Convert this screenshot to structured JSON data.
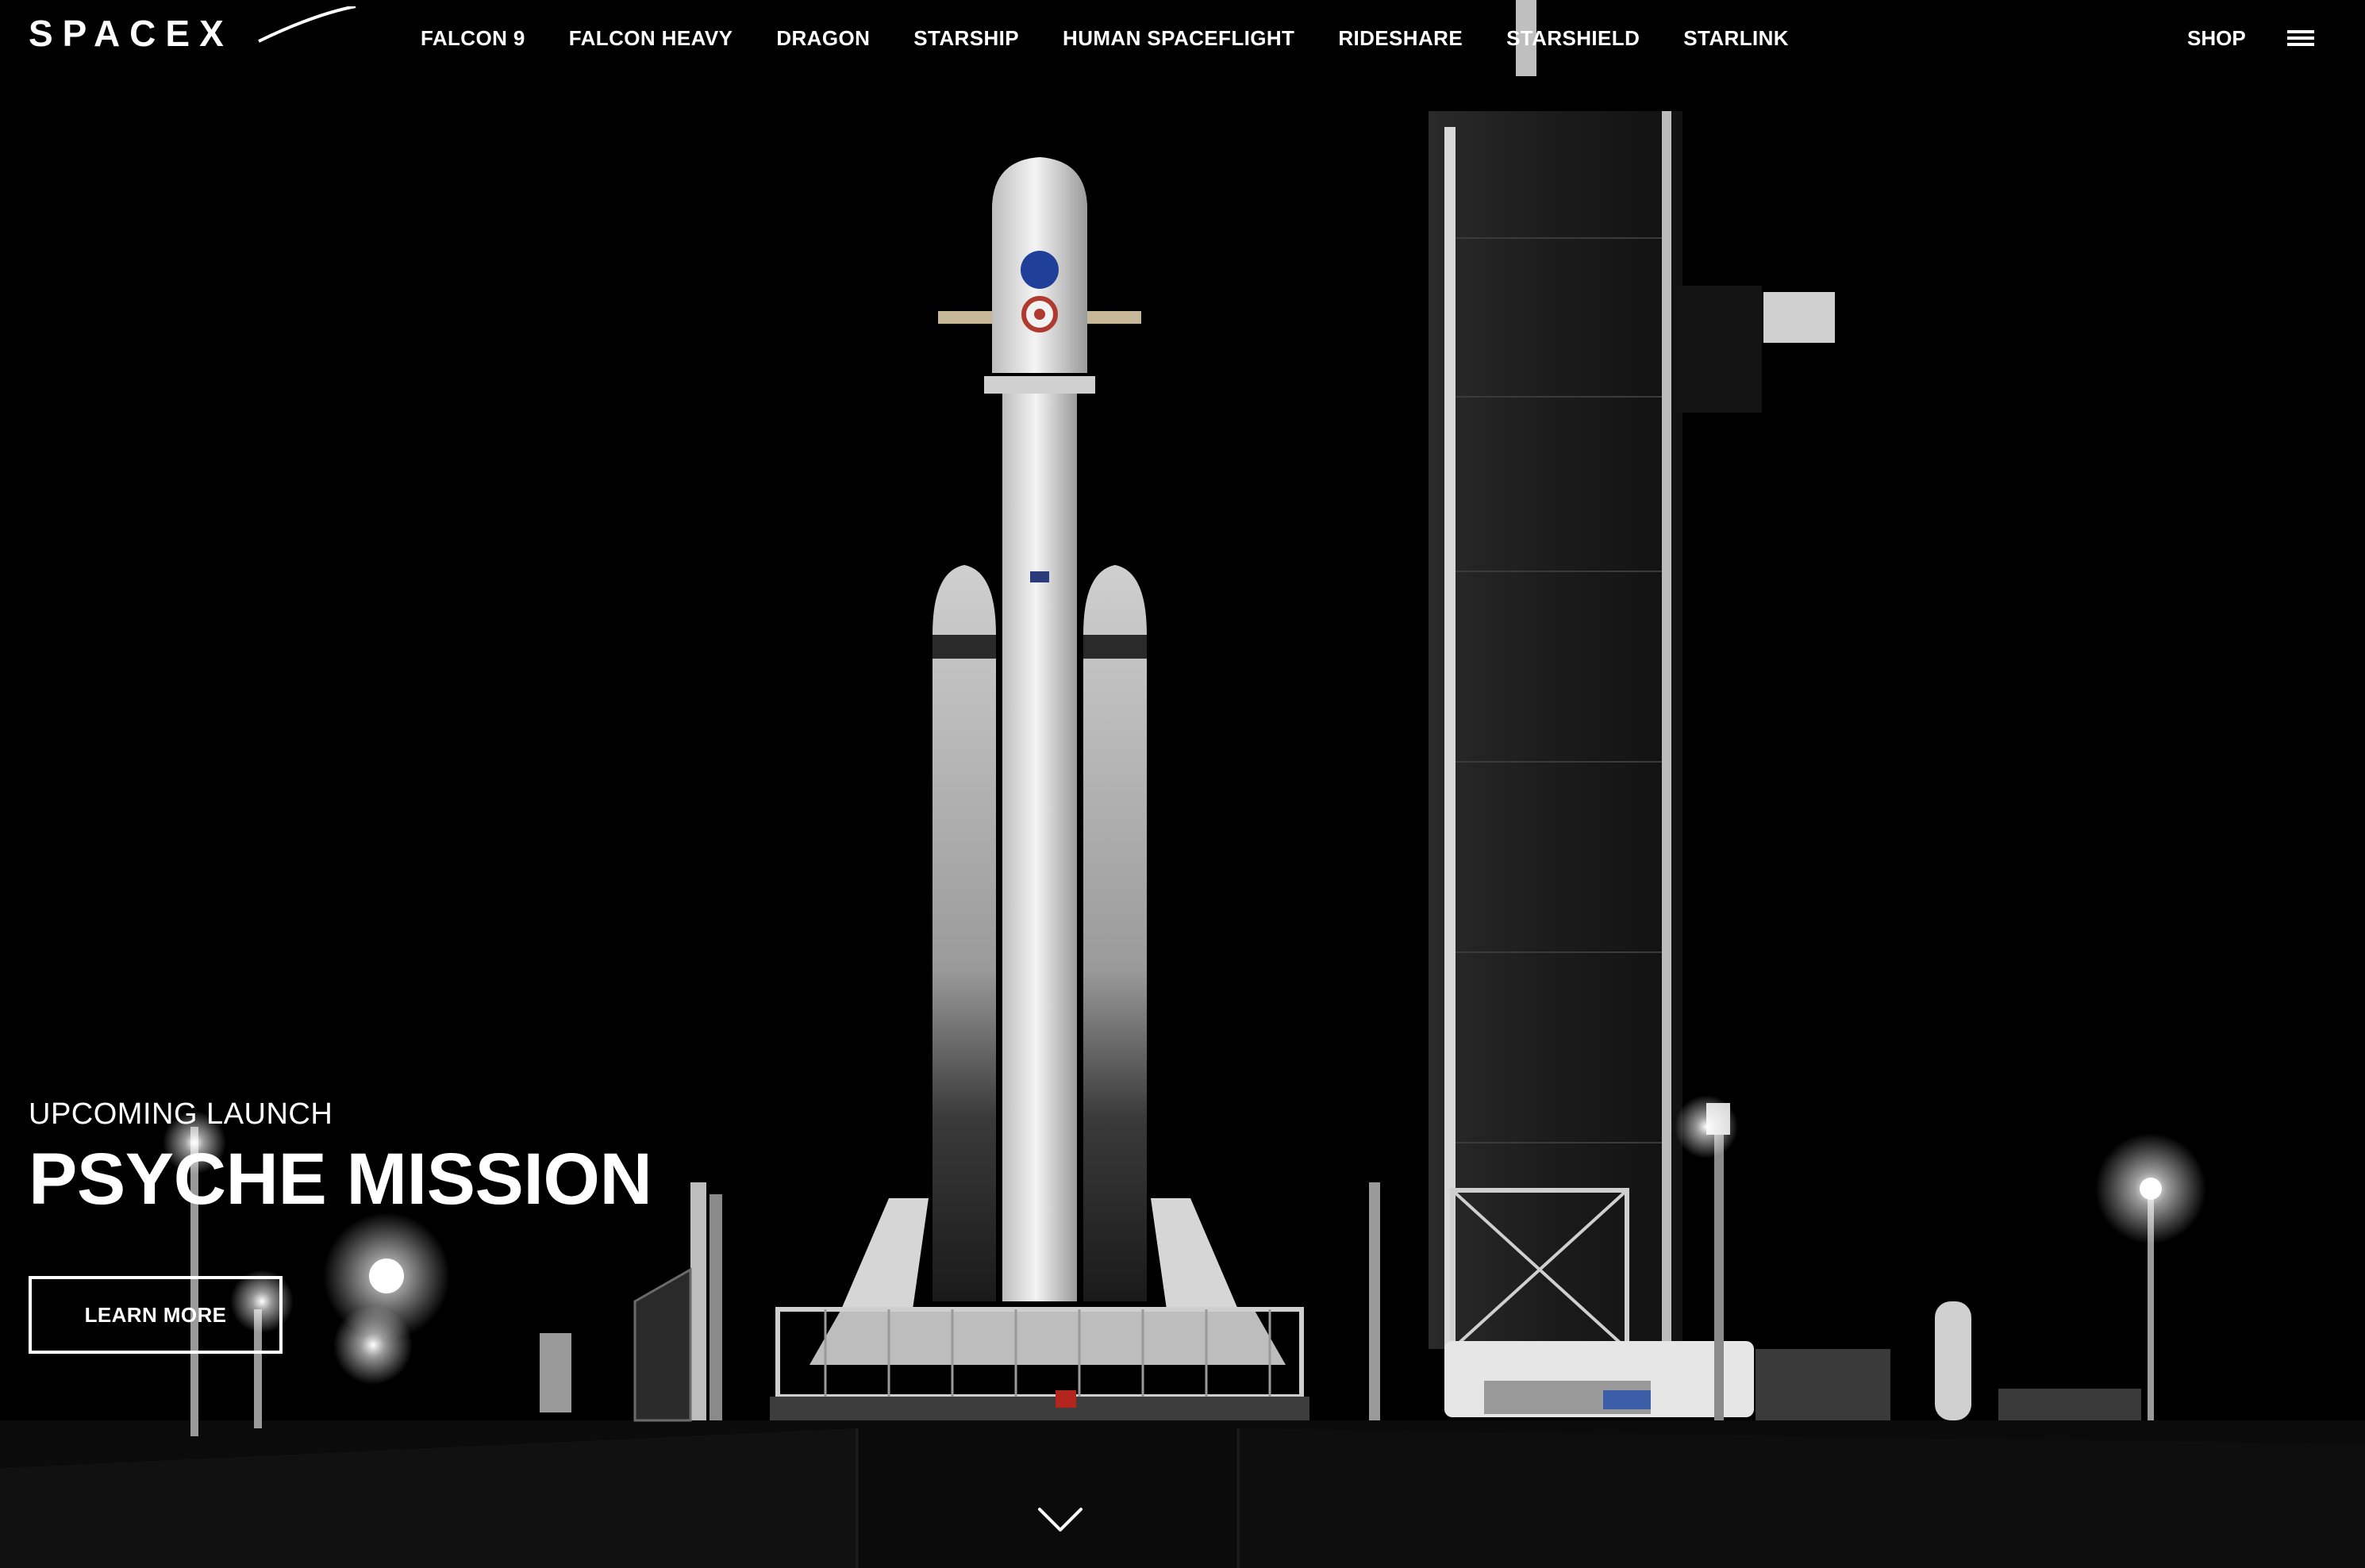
{
  "brand": {
    "name": "SPACEX"
  },
  "nav": {
    "items": [
      {
        "label": "FALCON 9"
      },
      {
        "label": "FALCON HEAVY"
      },
      {
        "label": "DRAGON"
      },
      {
        "label": "STARSHIP"
      },
      {
        "label": "HUMAN SPACEFLIGHT"
      },
      {
        "label": "RIDESHARE"
      },
      {
        "label": "STARSHIELD"
      },
      {
        "label": "STARLINK"
      }
    ],
    "shop_label": "SHOP",
    "menu_icon": "hamburger-menu-icon"
  },
  "hero": {
    "eyebrow": "UPCOMING LAUNCH",
    "title": "PSYCHE MISSION",
    "cta_label": "LEARN MORE",
    "scroll_icon": "chevron-down-icon",
    "background": {
      "sky": "#000000",
      "ground": "#0a0a0a",
      "rocket": "#e8e8e8"
    }
  }
}
